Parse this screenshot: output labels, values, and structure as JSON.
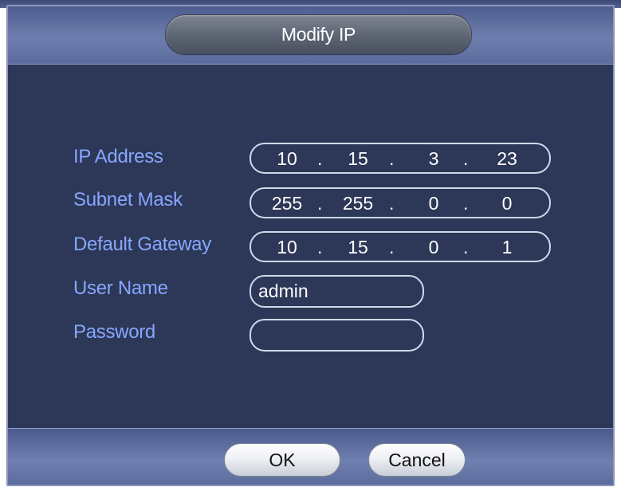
{
  "dialog": {
    "title": "Modify IP"
  },
  "fields": {
    "ip_address": {
      "label": "IP Address",
      "octets": [
        "10",
        "15",
        "3",
        "23"
      ]
    },
    "subnet_mask": {
      "label": "Subnet Mask",
      "octets": [
        "255",
        "255",
        "0",
        "0"
      ]
    },
    "default_gateway": {
      "label": "Default Gateway",
      "octets": [
        "10",
        "15",
        "0",
        "1"
      ]
    },
    "user_name": {
      "label": "User Name",
      "value": "admin"
    },
    "password": {
      "label": "Password",
      "value": ""
    }
  },
  "separator": ".",
  "buttons": {
    "ok": "OK",
    "cancel": "Cancel"
  }
}
